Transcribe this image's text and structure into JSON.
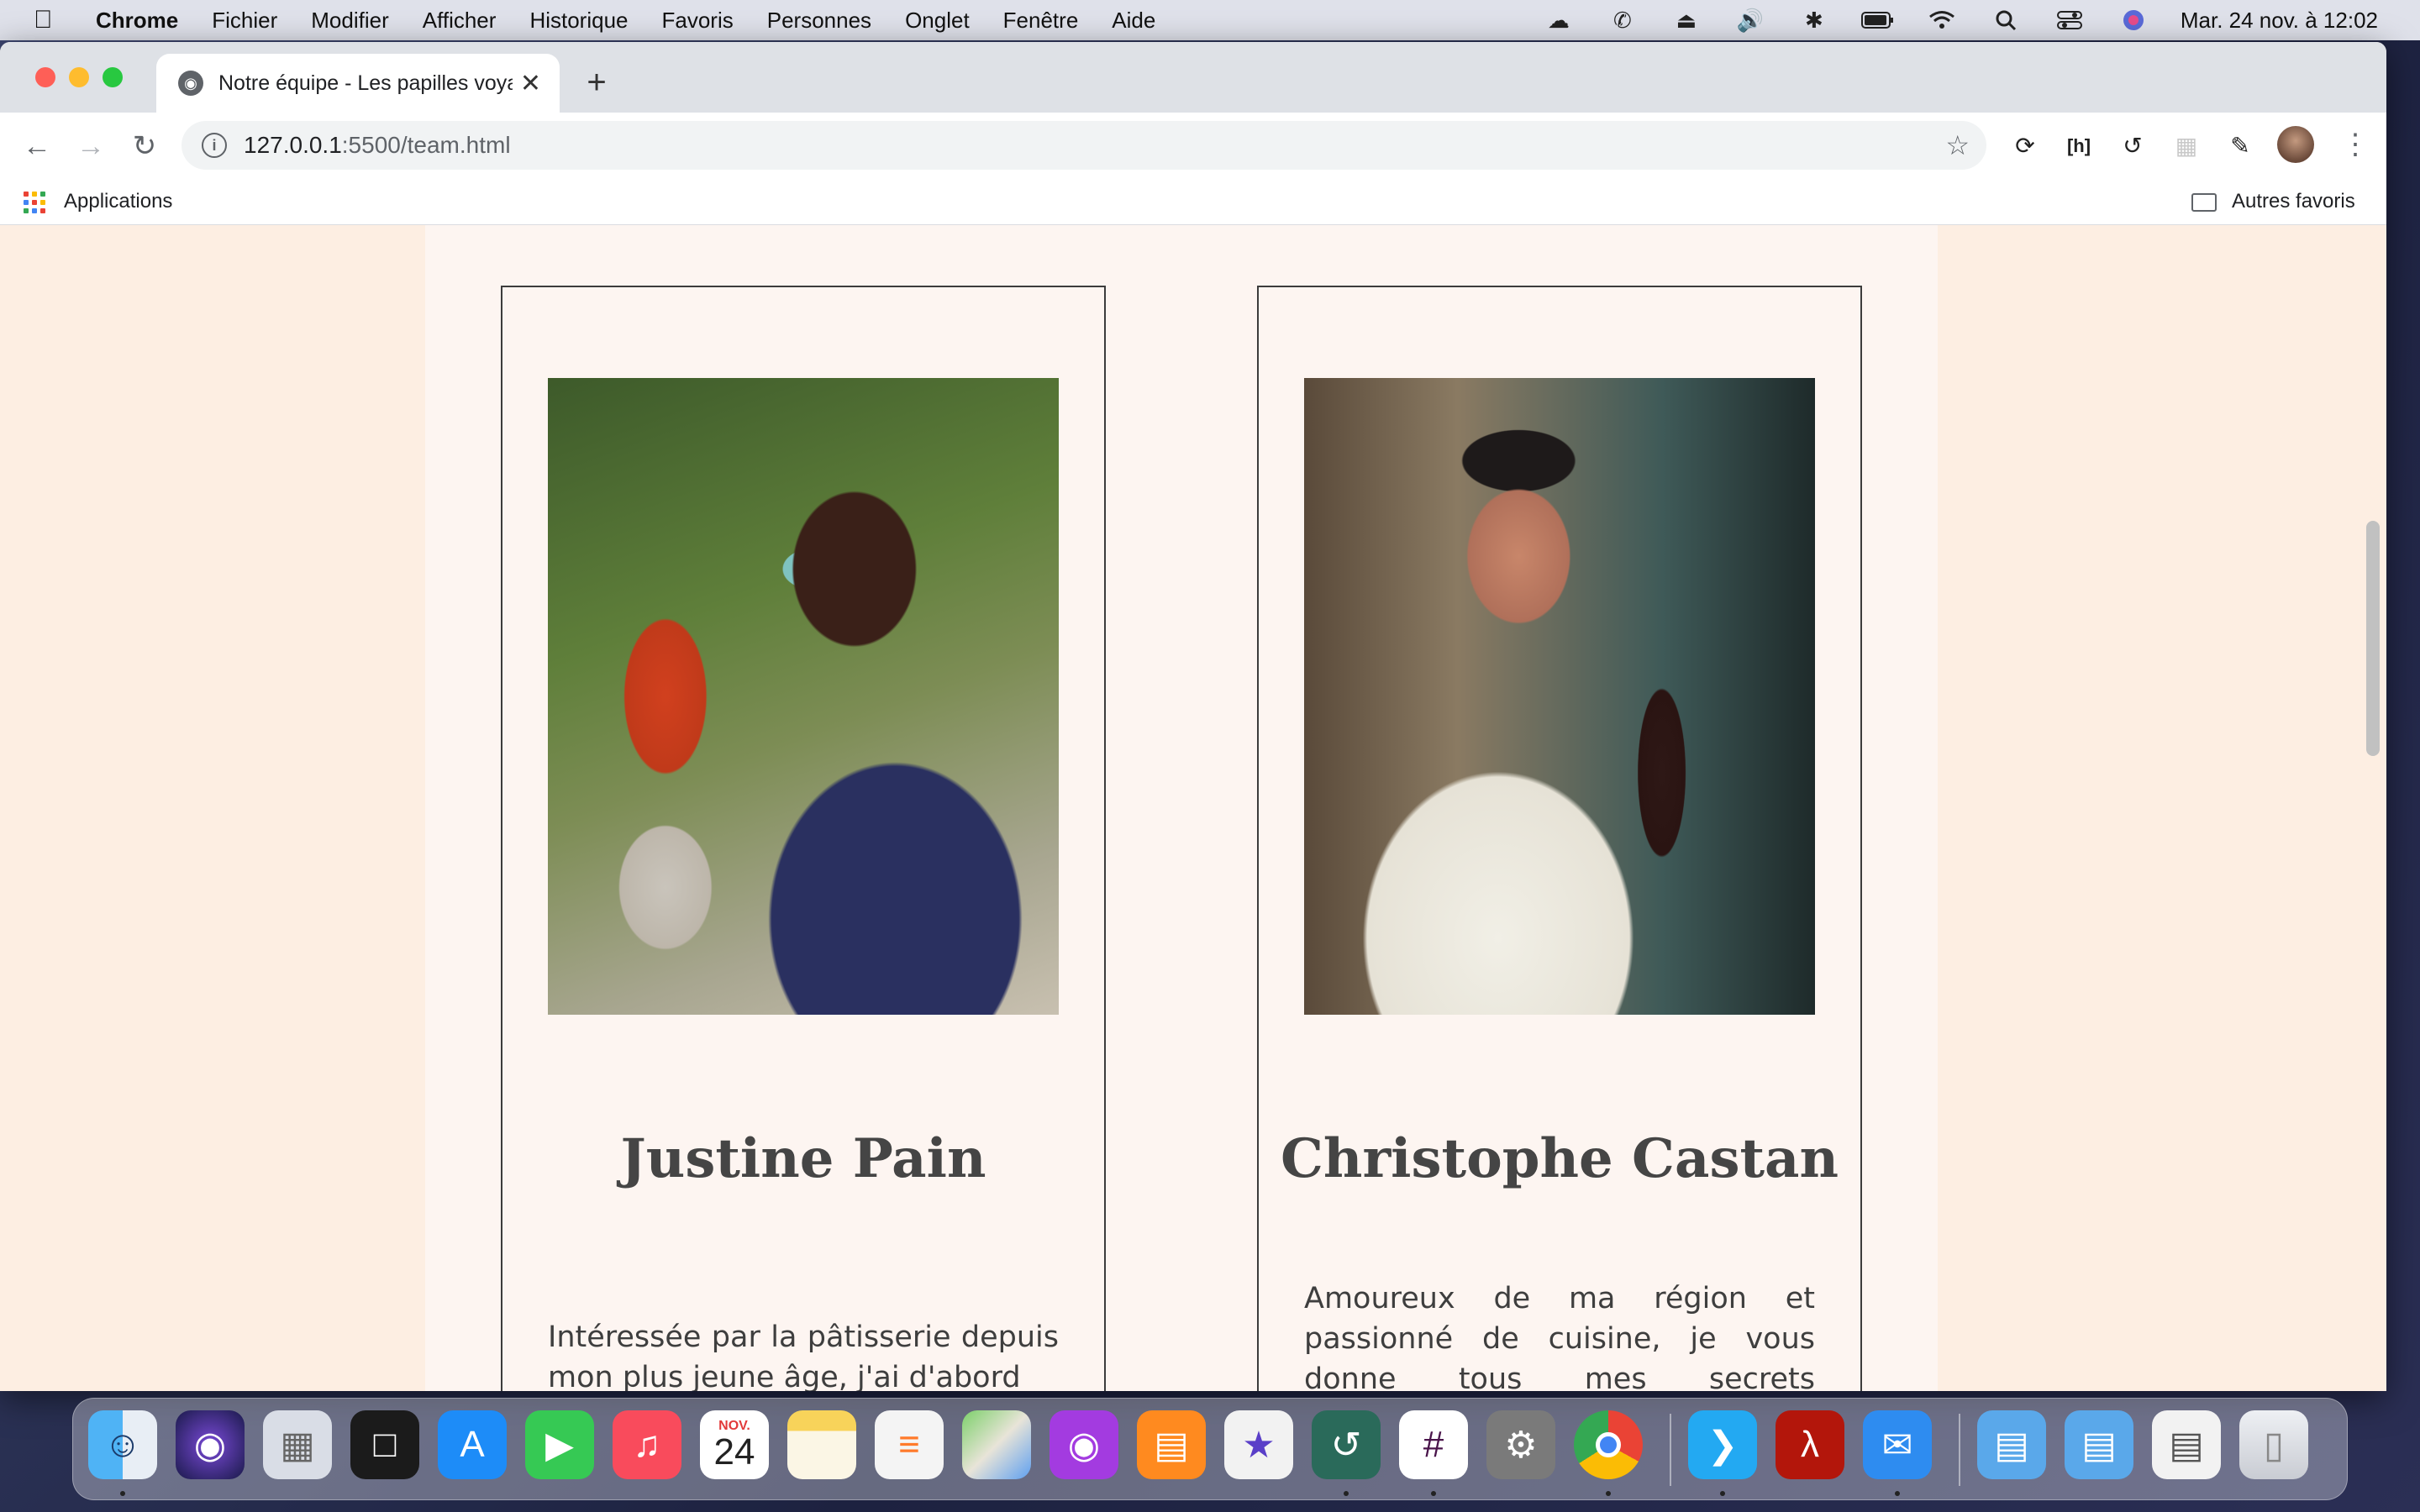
{
  "menubar": {
    "app_name": "Chrome",
    "items": [
      "Fichier",
      "Modifier",
      "Afficher",
      "Historique",
      "Favoris",
      "Personnes",
      "Onglet",
      "Fenêtre",
      "Aide"
    ],
    "clock": "Mar. 24 nov. à  12:02",
    "status_icons": [
      "cloud-upload-icon",
      "phone-icon",
      "eject-icon",
      "volume-icon",
      "bluetooth-icon",
      "battery-icon",
      "wifi-icon",
      "spotlight-search-icon",
      "control-center-icon",
      "siri-icon"
    ]
  },
  "browser": {
    "tab_title": "Notre équipe - Les papilles voyageuses",
    "url_host": "127.0.0.1",
    "url_rest": ":5500/team.html",
    "bookmarks": {
      "apps_label": "Applications",
      "other_label": "Autres favoris"
    }
  },
  "team": {
    "members": [
      {
        "name": "Justine Pain",
        "bio": "Intéressée par la pâtisserie depuis mon plus jeune âge, j'ai d'abord"
      },
      {
        "name": "Christophe Castan",
        "bio": "Amoureux de ma région et passionné de cuisine, je vous donne tous mes secrets culinaires, sans"
      }
    ]
  },
  "dock": {
    "calendar_month": "NOV.",
    "calendar_day": "24",
    "apps": [
      "finder-icon",
      "siri-icon",
      "launchpad-icon",
      "mission-control-icon",
      "app-store-icon",
      "facetime-icon",
      "music-icon",
      "calendar-icon",
      "notes-icon",
      "reminders-icon",
      "maps-icon",
      "podcasts-icon",
      "books-icon",
      "imovie-icon",
      "time-machine-icon",
      "slack-icon",
      "system-preferences-icon",
      "chrome-icon",
      "vscode-icon",
      "acrobat-icon",
      "mail-icon",
      "folder-icon",
      "folder-icon",
      "preview-icon",
      "trash-icon"
    ]
  }
}
